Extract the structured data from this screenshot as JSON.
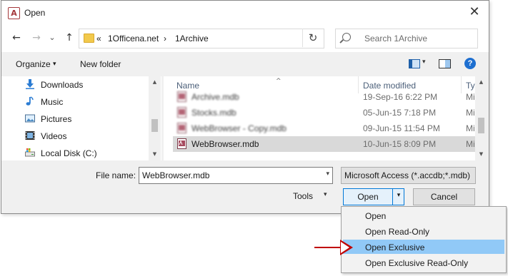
{
  "window": {
    "title": "Open",
    "close_glyph": "✕",
    "app_icon_letter": "A"
  },
  "nav": {
    "back_glyph": "←",
    "forward_glyph": "→",
    "history_caret": "⌄",
    "up_glyph": "↑",
    "breadcrumb": {
      "overflow": "«",
      "items": [
        "1Officena.net",
        "1Archive"
      ],
      "separator": "›"
    },
    "refresh_glyph": "↻",
    "search_placeholder": "Search 1Archive"
  },
  "toolbar": {
    "organize_label": "Organize",
    "organize_caret": "▾",
    "new_folder_label": "New folder",
    "help_glyph": "?"
  },
  "sidebar": {
    "items": [
      {
        "label": "Downloads",
        "icon": "download-icon"
      },
      {
        "label": "Music",
        "icon": "music-icon"
      },
      {
        "label": "Pictures",
        "icon": "pictures-icon"
      },
      {
        "label": "Videos",
        "icon": "videos-icon"
      },
      {
        "label": "Local Disk (C:)",
        "icon": "drive-icon"
      }
    ]
  },
  "filelist": {
    "columns": [
      {
        "label": "Name"
      },
      {
        "label": "Date modified"
      },
      {
        "label": "Typ"
      }
    ],
    "sort_caret": "^",
    "rows": [
      {
        "name": "Archive.mdb",
        "date": "19-Sep-16 6:22 PM",
        "type": "Mi",
        "blurred": true,
        "selected": false
      },
      {
        "name": "Stocks.mdb",
        "date": "05-Jun-15 7:18 PM",
        "type": "Mi",
        "blurred": true,
        "selected": false
      },
      {
        "name": "WebBrowser - Copy.mdb",
        "date": "09-Jun-15 11:54 PM",
        "type": "Mi",
        "blurred": true,
        "selected": false
      },
      {
        "name": "WebBrowser.mdb",
        "date": "10-Jun-15 8:09 PM",
        "type": "Mi",
        "blurred": false,
        "selected": true
      }
    ]
  },
  "footer": {
    "file_name_label": "File name:",
    "file_name_value": "WebBrowser.mdb",
    "file_type_value": "Microsoft Access (*.accdb;*.mdb)",
    "tools_label": "Tools",
    "open_label": "Open",
    "cancel_label": "Cancel",
    "caret": "▾"
  },
  "open_menu": {
    "items": [
      "Open",
      "Open Read-Only",
      "Open Exclusive",
      "Open Exclusive Read-Only"
    ],
    "highlighted_index": 2
  },
  "colors": {
    "accent": "#0078d7",
    "highlight": "#91c9f7",
    "annotation_arrow": "#c00000"
  }
}
